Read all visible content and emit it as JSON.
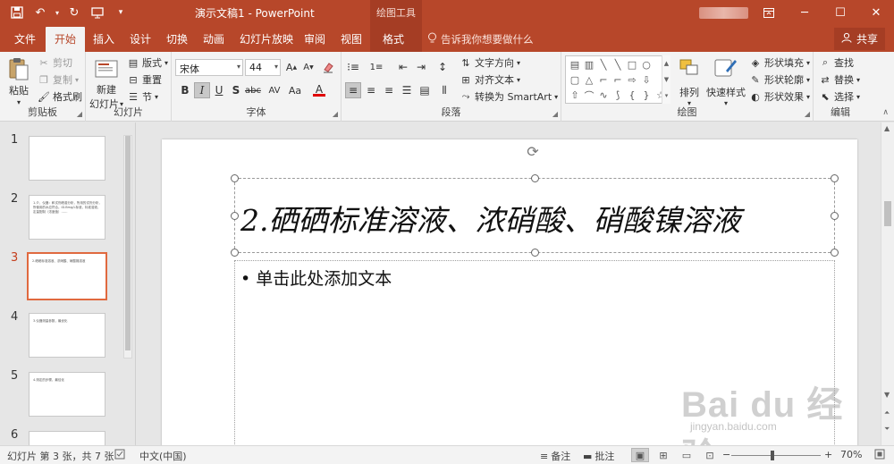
{
  "titlebar": {
    "document_title": "演示文稿1  -  PowerPoint",
    "contextual_group": "绘图工具",
    "colors": {
      "accent": "#b7472a",
      "active_slide_border": "#e0693f"
    }
  },
  "tabs": {
    "file": "文件",
    "home": "开始",
    "insert": "插入",
    "design": "设计",
    "transitions": "切换",
    "animations": "动画",
    "slideshow": "幻灯片放映",
    "review": "审阅",
    "view": "视图",
    "format": "格式",
    "tell_me": "告诉我你想要做什么",
    "share": "共享"
  },
  "ribbon": {
    "clipboard": {
      "label": "剪贴板",
      "paste": "粘贴",
      "cut": "剪切",
      "copy": "复制",
      "format_painter": "格式刷"
    },
    "slides": {
      "label": "幻灯片",
      "new_slide_line1": "新建",
      "new_slide_line2": "幻灯片",
      "layout": "版式",
      "reset": "重置",
      "section": "节"
    },
    "font": {
      "label": "字体",
      "font_name": "宋体",
      "font_size": "44"
    },
    "paragraph": {
      "label": "段落",
      "text_direction": "文字方向",
      "align_text": "对齐文本",
      "smartart": "转换为 SmartArt"
    },
    "drawing": {
      "label": "绘图",
      "arrange": "排列",
      "quick_styles": "快速样式",
      "shape_fill": "形状填充",
      "shape_outline": "形状轮廓",
      "shape_effects": "形状效果"
    },
    "editing": {
      "label": "编辑",
      "find": "查找",
      "replace": "替换",
      "select": "选择"
    }
  },
  "thumbnails": {
    "slides": [
      {
        "number": "1",
        "text": ""
      },
      {
        "number": "2",
        "text": "1.介、仪器：和试剂硒溶分析，所用的试剂分析，所使用的水应符合。iD.Bmg/L标液，标准溶液，定量配制（浓度值）……"
      },
      {
        "number": "3",
        "text": "2.硒硒标准溶液、浓硝酸、硝酸镍溶液"
      },
      {
        "number": "4",
        "text": "3.仪器测量参数，最优化"
      },
      {
        "number": "5",
        "text": "4.测定的步骤，最佳化"
      },
      {
        "number": "6",
        "text": ""
      }
    ]
  },
  "slide": {
    "title": "2.硒硒标准溶液、浓硝酸、硝酸镍溶液",
    "body_placeholder": "• 单击此处添加文本"
  },
  "watermark": {
    "main": "Bai du 经验",
    "sub": "jingyan.baidu.com"
  },
  "statusbar": {
    "slide_info": "幻灯片 第 3 张，共 7 张",
    "language": "中文(中国)",
    "notes": "备注",
    "comments": "批注",
    "zoom": "70%"
  }
}
